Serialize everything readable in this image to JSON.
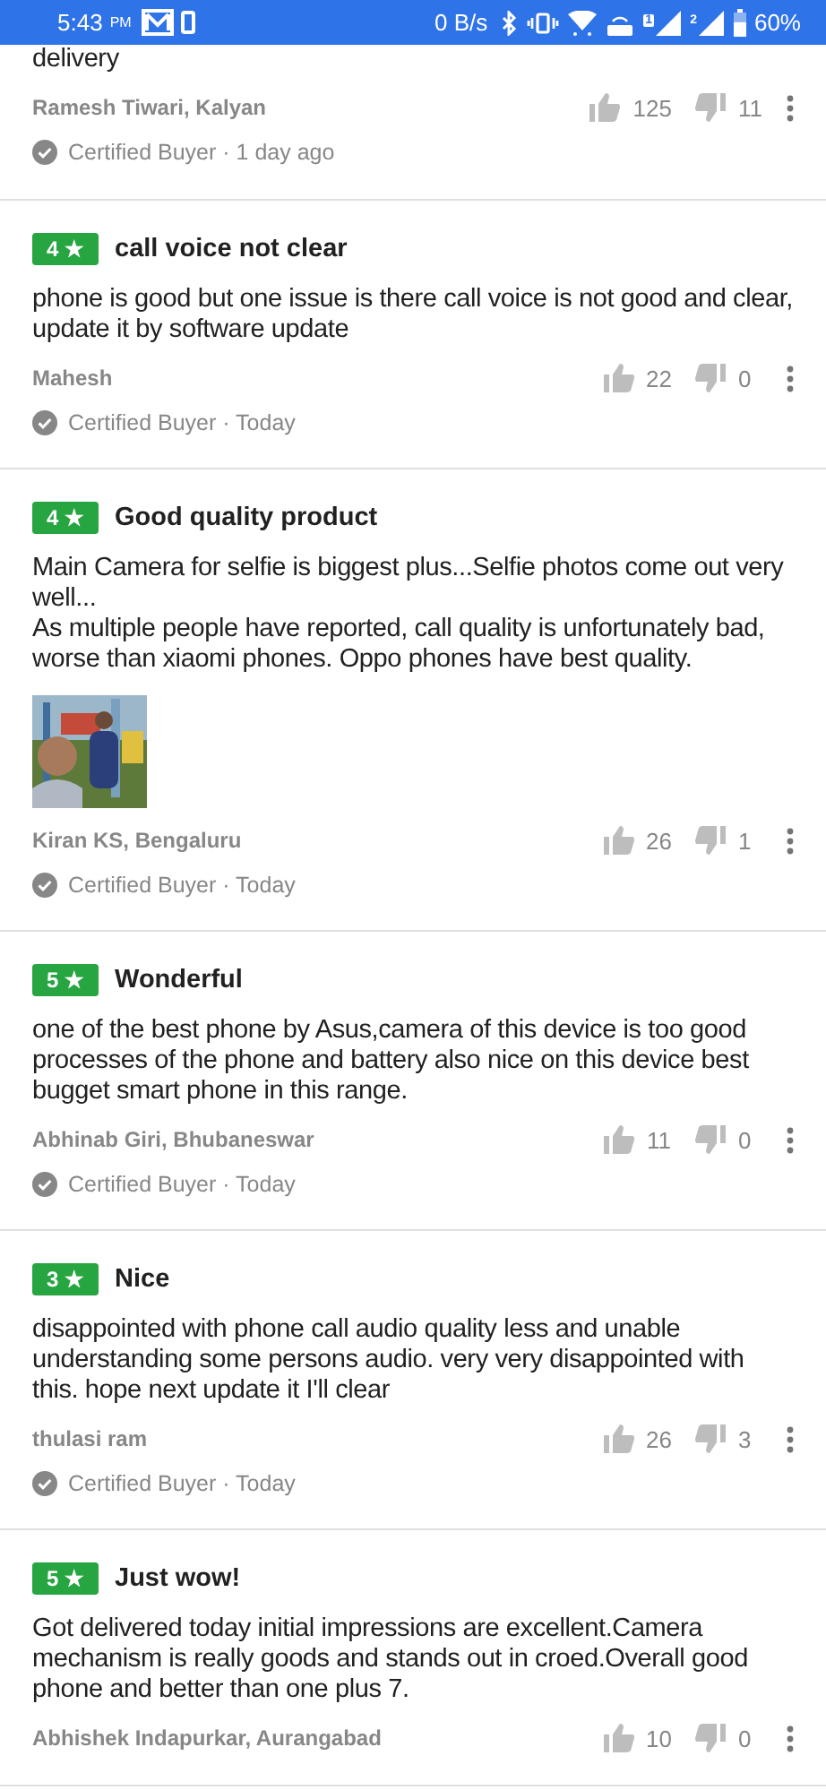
{
  "status_bar": {
    "time": "5:43",
    "ampm": "PM",
    "speed": "0 B/s",
    "sims": [
      "1",
      "2"
    ],
    "battery": "60%"
  },
  "reviews": [
    {
      "body": "delivery",
      "author": "Ramesh  Tiwari, Kalyan",
      "likes": "125",
      "dislikes": "11",
      "certified": "Certified Buyer · 1 day ago"
    },
    {
      "rating": "4 ★",
      "title": "call voice not clear",
      "body": "phone is good but one issue is there call voice is not good and clear, update it by software update",
      "author": "Mahesh",
      "likes": "22",
      "dislikes": "0",
      "certified": "Certified Buyer · Today"
    },
    {
      "rating": "4 ★",
      "title": "Good quality product",
      "body": "Main Camera for selfie is biggest plus...Selfie photos come out very well...\nAs multiple people have reported, call quality is unfortunately bad, worse than xiaomi phones. Oppo phones have best quality.",
      "author": "Kiran KS, Bengaluru",
      "likes": "26",
      "dislikes": "1",
      "certified": "Certified Buyer · Today"
    },
    {
      "rating": "5 ★",
      "title": "Wonderful",
      "body": "one of the best phone by Asus,camera of this device is too good processes of the phone and  battery also nice on this device best bugget smart phone in this range.",
      "author": "Abhinab Giri, Bhubaneswar",
      "likes": "11",
      "dislikes": "0",
      "certified": "Certified Buyer · Today"
    },
    {
      "rating": "3 ★",
      "title": "Nice",
      "body": "disappointed with phone call audio quality less and unable understanding some persons audio. very very disappointed with this. hope next update it I'll clear",
      "author": "thulasi ram",
      "likes": "26",
      "dislikes": "3",
      "certified": "Certified Buyer · Today"
    },
    {
      "rating": "5 ★",
      "title": "Just wow!",
      "body": "Got delivered today initial impressions are excellent.Camera mechanism is really goods and stands out in croed.Overall good phone and better than one plus 7.",
      "author": "Abhishek Indapurkar, Aurangabad",
      "likes": "10",
      "dislikes": "0"
    }
  ]
}
